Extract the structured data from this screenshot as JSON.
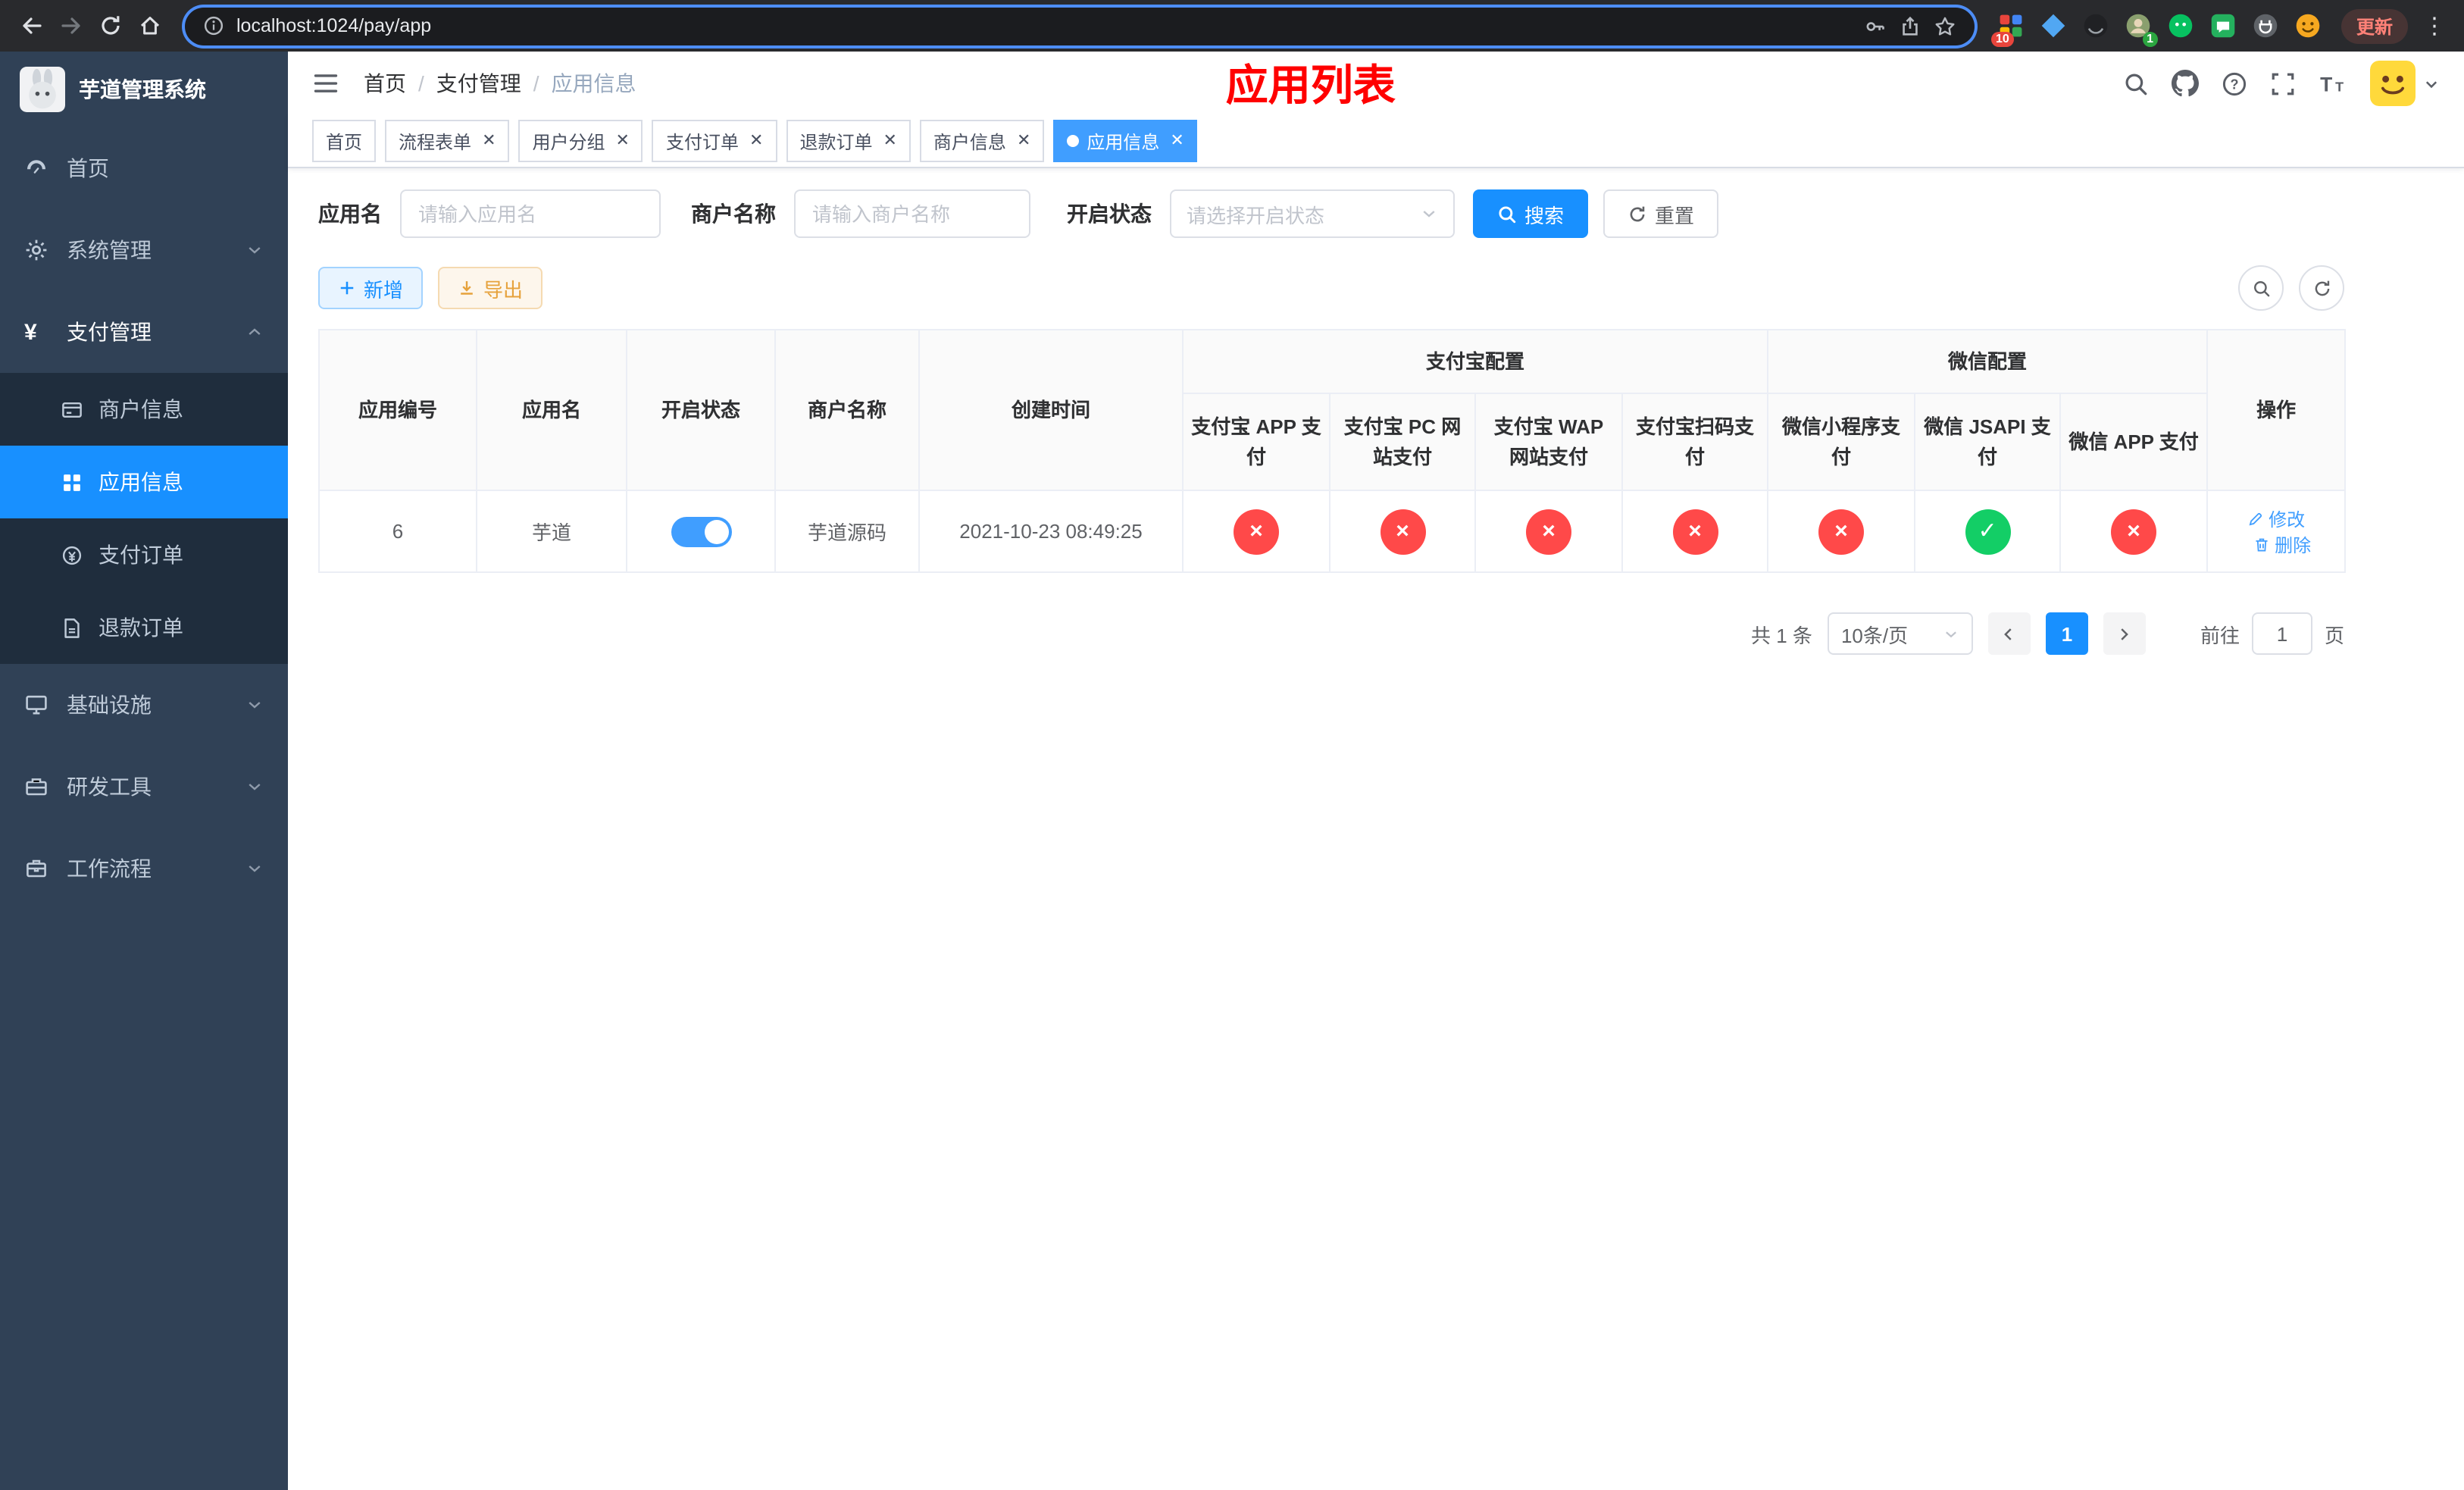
{
  "colors": {
    "accent_blue": "#409eff",
    "primary_blue": "#1890ff",
    "title_red": "#ff0000",
    "status_off_red": "#ff4949",
    "status_on_green": "#13ce66",
    "warning_yellow": "#e6a23c",
    "sidebar_bg": "#304156",
    "submenu_bg": "#1f2d3d"
  },
  "browser": {
    "url": "localhost:1024/pay/app",
    "update_button": "更新",
    "ext_badge_count": "10",
    "profile_badge_count": "1"
  },
  "sidebar": {
    "title": "芋道管理系统",
    "items": [
      {
        "label": "首页"
      },
      {
        "label": "系统管理"
      },
      {
        "label": "支付管理"
      },
      {
        "label": "基础设施"
      },
      {
        "label": "研发工具"
      },
      {
        "label": "工作流程"
      }
    ],
    "pay_children": [
      {
        "label": "商户信息"
      },
      {
        "label": "应用信息"
      },
      {
        "label": "支付订单"
      },
      {
        "label": "退款订单"
      }
    ]
  },
  "header": {
    "breadcrumb": [
      "首页",
      "支付管理",
      "应用信息"
    ],
    "title": "应用列表"
  },
  "tabs": [
    {
      "label": "首页"
    },
    {
      "label": "流程表单"
    },
    {
      "label": "用户分组"
    },
    {
      "label": "支付订单"
    },
    {
      "label": "退款订单"
    },
    {
      "label": "商户信息"
    },
    {
      "label": "应用信息"
    }
  ],
  "filters": {
    "app_name": {
      "label": "应用名",
      "placeholder": "请输入应用名",
      "value": ""
    },
    "merchant_name": {
      "label": "商户名称",
      "placeholder": "请输入商户名称",
      "value": ""
    },
    "status": {
      "label": "开启状态",
      "placeholder": "请选择开启状态"
    },
    "search": "搜索",
    "reset": "重置"
  },
  "toolbar": {
    "add": "新增",
    "export": "导出"
  },
  "table": {
    "columns": [
      "应用编号",
      "应用名",
      "开启状态",
      "商户名称",
      "创建时间"
    ],
    "groups": [
      {
        "label": "支付宝配置",
        "children": [
          "支付宝 APP 支付",
          "支付宝 PC 网站支付",
          "支付宝 WAP 网站支付",
          "支付宝扫码支付"
        ]
      },
      {
        "label": "微信配置",
        "children": [
          "微信小程序支付",
          "微信 JSAPI 支付",
          "微信 APP 支付"
        ]
      }
    ],
    "action_column": "操作",
    "rows": [
      {
        "id": "6",
        "name": "芋道",
        "status_enabled": true,
        "merchant": "芋道源码",
        "create_time": "2021-10-23 08:49:25",
        "configs": [
          false,
          false,
          false,
          false,
          false,
          true,
          false
        ],
        "actions": [
          "修改",
          "删除"
        ]
      }
    ]
  },
  "pagination": {
    "total": "共 1 条",
    "page_size": "10条/页",
    "current": "1",
    "goto_label": "前往",
    "goto_value": "1",
    "goto_suffix": "页"
  }
}
